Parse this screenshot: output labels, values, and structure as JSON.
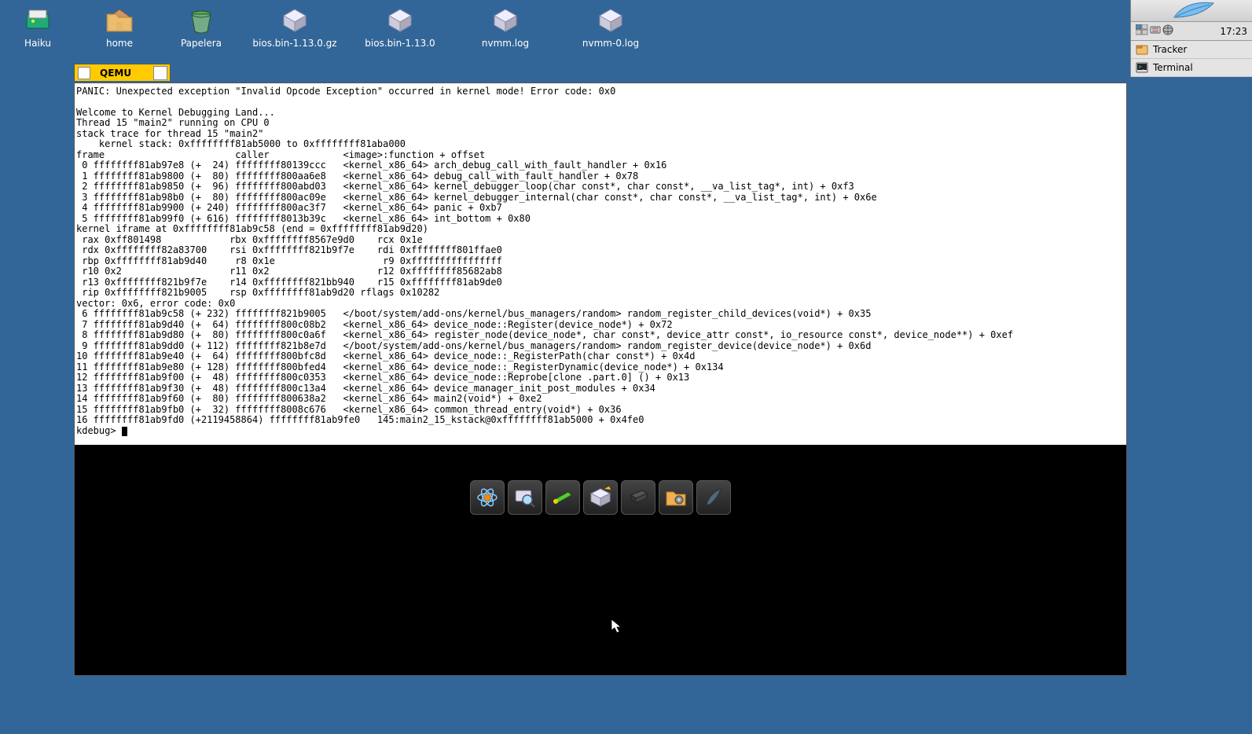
{
  "desktop": {
    "icons": [
      {
        "name": "haiku-volume",
        "label": "Haiku"
      },
      {
        "name": "home-folder",
        "label": "home"
      },
      {
        "name": "trash",
        "label": "Papelera"
      },
      {
        "name": "file-bios-gz",
        "label": "bios.bin-1.13.0.gz"
      },
      {
        "name": "file-bios",
        "label": "bios.bin-1.13.0"
      },
      {
        "name": "file-nvmm-log",
        "label": "nvmm.log"
      },
      {
        "name": "file-nvmm0-log",
        "label": "nvmm-0.log"
      }
    ]
  },
  "qemu": {
    "title": "QEMU",
    "panic": "PANIC: Unexpected exception \"Invalid Opcode Exception\" occurred in kernel mode! Error code: 0x0",
    "welcome": "Welcome to Kernel Debugging Land...",
    "thread": "Thread 15 \"main2\" running on CPU 0",
    "stacktrace_hdr": "stack trace for thread 15 \"main2\"",
    "kernel_stack": "    kernel stack: 0xffffffff81ab5000 to 0xffffffff81aba000",
    "columns": "frame                       caller             <image>:function + offset",
    "frames_a": [
      " 0 ffffffff81ab97e8 (+  24) ffffffff80139ccc   <kernel_x86_64> arch_debug_call_with_fault_handler + 0x16",
      " 1 ffffffff81ab9800 (+  80) ffffffff800aa6e8   <kernel_x86_64> debug_call_with_fault_handler + 0x78",
      " 2 ffffffff81ab9850 (+  96) ffffffff800abd03   <kernel_x86_64> kernel_debugger_loop(char const*, char const*, __va_list_tag*, int) + 0xf3",
      " 3 ffffffff81ab98b0 (+  80) ffffffff800ac09e   <kernel_x86_64> kernel_debugger_internal(char const*, char const*, __va_list_tag*, int) + 0x6e",
      " 4 ffffffff81ab9900 (+ 240) ffffffff800ac3f7   <kernel_x86_64> panic + 0xb7",
      " 5 ffffffff81ab99f0 (+ 616) ffffffff8013b39c   <kernel_x86_64> int_bottom + 0x80"
    ],
    "iframe_hdr": "kernel iframe at 0xffffffff81ab9c58 (end = 0xffffffff81ab9d20)",
    "regs": [
      " rax 0xff801498            rbx 0xffffffff8567e9d0    rcx 0x1e",
      " rdx 0xffffffff82a83700    rsi 0xffffffff821b9f7e    rdi 0xffffffff801ffae0",
      " rbp 0xffffffff81ab9d40     r8 0x1e                   r9 0xffffffffffffffff",
      " r10 0x2                   r11 0x2                   r12 0xffffffff85682ab8",
      " r13 0xffffffff821b9f7e    r14 0xffffffff821bb940    r15 0xffffffff81ab9de0",
      " rip 0xffffffff821b9005    rsp 0xffffffff81ab9d20 rflags 0x10282"
    ],
    "vector": "vector: 0x6, error code: 0x0",
    "frames_b": [
      " 6 ffffffff81ab9c58 (+ 232) ffffffff821b9005   </boot/system/add-ons/kernel/bus_managers/random> random_register_child_devices(void*) + 0x35",
      " 7 ffffffff81ab9d40 (+  64) ffffffff800c08b2   <kernel_x86_64> device_node::Register(device_node*) + 0x72",
      " 8 ffffffff81ab9d80 (+  80) ffffffff800c0a6f   <kernel_x86_64> register_node(device_node*, char const*, device_attr const*, io_resource const*, device_node**) + 0xef",
      " 9 ffffffff81ab9dd0 (+ 112) ffffffff821b8e7d   </boot/system/add-ons/kernel/bus_managers/random> random_register_device(device_node*) + 0x6d",
      "10 ffffffff81ab9e40 (+  64) ffffffff800bfc8d   <kernel_x86_64> device_node::_RegisterPath(char const*) + 0x4d",
      "11 ffffffff81ab9e80 (+ 128) ffffffff800bfed4   <kernel_x86_64> device_node::_RegisterDynamic(device_node*) + 0x134",
      "12 ffffffff81ab9f00 (+  48) ffffffff800c0353   <kernel_x86_64> device_node::Reprobe[clone .part.0] () + 0x13",
      "13 ffffffff81ab9f30 (+  48) ffffffff800c13a4   <kernel_x86_64> device_manager_init_post_modules + 0x34",
      "14 ffffffff81ab9f60 (+  80) ffffffff800638a2   <kernel_x86_64> main2(void*) + 0xe2",
      "15 ffffffff81ab9fb0 (+  32) ffffffff8008c676   <kernel_x86_64> common_thread_entry(void*) + 0x36",
      "16 ffffffff81ab9fd0 (+2119458864) ffffffff81ab9fe0   145:main2_15_kstack@0xffffffff81ab5000 + 0x4fe0"
    ],
    "prompt": "kdebug> ",
    "dock": [
      {
        "name": "activity-monitor",
        "title": "ActivityMonitor"
      },
      {
        "name": "magnify",
        "title": "Magnify"
      },
      {
        "name": "disk-probe",
        "title": "DiskProbe"
      },
      {
        "name": "drive-setup",
        "title": "DriveSetup"
      },
      {
        "name": "devices",
        "title": "Devices"
      },
      {
        "name": "preferences",
        "title": "Preferences"
      },
      {
        "name": "stylededit",
        "title": "StyledEdit"
      }
    ]
  },
  "deskbar": {
    "clock": "17:23",
    "apps": [
      {
        "name": "tracker",
        "label": "Tracker"
      },
      {
        "name": "terminal",
        "label": "Terminal"
      }
    ]
  }
}
